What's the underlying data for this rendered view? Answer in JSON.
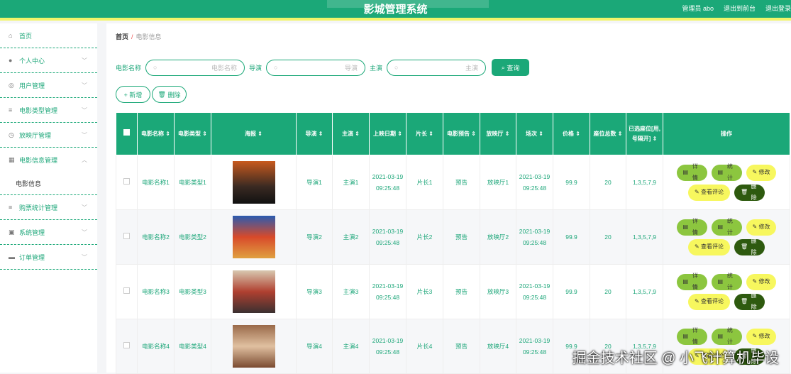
{
  "header": {
    "title": "影城管理系统",
    "user": "管理员 abo",
    "front": "退出到前台",
    "logout": "退出登录"
  },
  "sidebar": {
    "items": [
      {
        "label": "首页",
        "icon": "home-icon",
        "glyph": "⌂"
      },
      {
        "label": "个人中心",
        "icon": "user-icon",
        "glyph": "●"
      },
      {
        "label": "用户管理",
        "icon": "users-icon",
        "glyph": "◎"
      },
      {
        "label": "电影类型管理",
        "icon": "list-icon",
        "glyph": "≡"
      },
      {
        "label": "放映厅管理",
        "icon": "clock-icon",
        "glyph": "◷"
      },
      {
        "label": "电影信息管理",
        "icon": "grid-icon",
        "glyph": "▦"
      },
      {
        "label": "购票统计管理",
        "icon": "list-icon",
        "glyph": "≡"
      },
      {
        "label": "系统管理",
        "icon": "settings-icon",
        "glyph": "▣"
      },
      {
        "label": "订单管理",
        "icon": "monitor-icon",
        "glyph": "▬"
      }
    ],
    "sub": "电影信息"
  },
  "breadcrumb": {
    "home": "首页",
    "current": "电影信息"
  },
  "filters": {
    "name_label": "电影名称",
    "name_ph": "电影名称",
    "director_label": "导演",
    "director_ph": "导演",
    "actor_label": "主演",
    "actor_ph": "主演",
    "query": "查询"
  },
  "actions": {
    "add": "+ 新增",
    "delete": "删除"
  },
  "columns": [
    "电影名称",
    "电影类型",
    "海报",
    "导演",
    "主演",
    "上映日期",
    "片长",
    "电影预告",
    "放映厅",
    "场次",
    "价格",
    "座位总数",
    "已选座位[用,号隔开]",
    "操作"
  ],
  "ops": {
    "detail": "详情",
    "stats": "统计",
    "edit": "修改",
    "review": "查看评论",
    "delete": "删除"
  },
  "rows": [
    {
      "name": "电影名称1",
      "type": "电影类型1",
      "director": "导演1",
      "actor": "主演1",
      "date": "2021-03-19 09:25:48",
      "length": "片长1",
      "trailer": "预告",
      "hall": "放映厅1",
      "session": "2021-03-19 09:25:48",
      "price": "99.9",
      "seats": "20",
      "selected": "1,3,5,7,9"
    },
    {
      "name": "电影名称2",
      "type": "电影类型2",
      "director": "导演2",
      "actor": "主演2",
      "date": "2021-03-19 09:25:48",
      "length": "片长2",
      "trailer": "预告",
      "hall": "放映厅2",
      "session": "2021-03-19 09:25:48",
      "price": "99.9",
      "seats": "20",
      "selected": "1,3,5,7,9"
    },
    {
      "name": "电影名称3",
      "type": "电影类型3",
      "director": "导演3",
      "actor": "主演3",
      "date": "2021-03-19 09:25:48",
      "length": "片长3",
      "trailer": "预告",
      "hall": "放映厅3",
      "session": "2021-03-19 09:25:48",
      "price": "99.9",
      "seats": "20",
      "selected": "1,3,5,7,9"
    },
    {
      "name": "电影名称4",
      "type": "电影类型4",
      "director": "导演4",
      "actor": "主演4",
      "date": "2021-03-19 09:25:48",
      "length": "片长4",
      "trailer": "预告",
      "hall": "放映厅4",
      "session": "2021-03-19 09:25:48",
      "price": "99.9",
      "seats": "20",
      "selected": "1,3,5,7,9"
    }
  ],
  "watermark": "掘金技术社区 @ 小飞计算机毕设"
}
